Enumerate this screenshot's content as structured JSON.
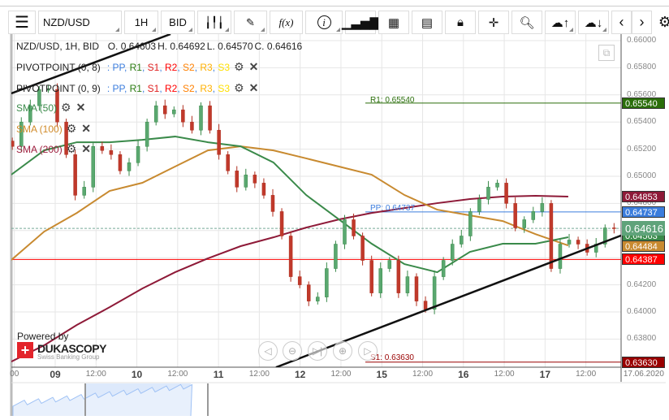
{
  "toolbar": {
    "menu_icon": "hamburger-icon",
    "symbol": "NZD/USD",
    "timeframe": "1H",
    "side": "BID",
    "buttons": [
      "candle-type-icon",
      "pencil-icon",
      "function-icon",
      "info-icon",
      "bar-chart-icon",
      "calendar-icon",
      "report-icon",
      "lock-icon",
      "crosshair-icon",
      "zoom-search-icon",
      "upload-icon",
      "download-icon",
      "chevron-left-icon",
      "chevron-right-icon",
      "gear-icon"
    ],
    "fx": "f(x)",
    "info": "i"
  },
  "ohlc": {
    "title": "NZD/USD, 1H, BID",
    "o": "O. 0.64603",
    "h": "H. 0.64692",
    "l": "L. 0.64570",
    "c": "C. 0.64616"
  },
  "indicators": [
    {
      "name": "PIVOTPOINT (0, 8)",
      "parts": [
        ": ",
        "PP",
        ", ",
        "R1",
        ", ",
        "S1",
        ", ",
        "R2",
        ", ",
        "S2",
        ", ",
        "R3",
        ", ",
        "S3"
      ]
    },
    {
      "name": "PIVOTPOINT (0, 9)",
      "parts": [
        ": ",
        "PP",
        ", ",
        "R1",
        ", ",
        "S1",
        ", ",
        "R2",
        ", ",
        "S2",
        ", ",
        "R3",
        ", ",
        "S3"
      ]
    },
    {
      "name": "SMA (50)",
      "color": "#3a8a4a"
    },
    {
      "name": "SMA (100)",
      "color": "#d08a28"
    },
    {
      "name": "SMA (200)",
      "color": "#a02040"
    }
  ],
  "pivot_colors": {
    "PP": "#3b7ddd",
    "R1": "#2a7a10",
    "S1": "#e02020",
    "R2": "#ff0000",
    "S2": "#ff8000",
    "R3": "#ffb000",
    "S3": "#ffe000"
  },
  "levels": {
    "r1": "R1: 0.65540",
    "pp": "PP: 0.64737",
    "s1": "S1: 0.63630"
  },
  "price_labels": [
    {
      "text": "0.65540",
      "value": 0.6554,
      "color": "#2a6e0a"
    },
    {
      "text": "0.64853",
      "value": 0.64853,
      "color": "#8e1a38"
    },
    {
      "text": "0.64737",
      "value": 0.64737,
      "color": "#3b7ddd"
    },
    {
      "text": "0.64563",
      "value": 0.64563,
      "color": "#3a8a4a"
    },
    {
      "text": "0.64616",
      "value": 0.64616,
      "color": "#5fa37a"
    },
    {
      "text": "0.64484",
      "value": 0.64484,
      "color": "#c88a30"
    },
    {
      "text": "0.64387",
      "value": 0.64387,
      "color": "#ff0000"
    },
    {
      "text": "0.63630",
      "value": 0.6363,
      "color": "#990000"
    }
  ],
  "powered_by": "Powered by",
  "brand": "DUKASCOPY",
  "brand_sub": "Swiss Banking Group",
  "chart_data": {
    "type": "candlestick",
    "symbol": "NZD/USD",
    "interval": "1H",
    "ylim": [
      0.6359,
      0.6605
    ],
    "yticks": [
      "0.66000",
      "0.65800",
      "0.65600",
      "0.65400",
      "0.65200",
      "0.65000",
      "0.64800",
      "0.64600",
      "0.64400",
      "0.64200",
      "0.64000",
      "0.63800"
    ],
    "xticks": [
      {
        "t": -12,
        "label": "00",
        "day": false
      },
      {
        "t": 0,
        "label": "09",
        "day": true
      },
      {
        "t": 12,
        "label": "12:00",
        "day": false
      },
      {
        "t": 24,
        "label": "10",
        "day": true
      },
      {
        "t": 36,
        "label": "12:00",
        "day": false
      },
      {
        "t": 48,
        "label": "11",
        "day": true
      },
      {
        "t": 60,
        "label": "12:00",
        "day": false
      },
      {
        "t": 72,
        "label": "12",
        "day": true
      },
      {
        "t": 84,
        "label": "12:00",
        "day": false
      },
      {
        "t": 96,
        "label": "15",
        "day": true
      },
      {
        "t": 108,
        "label": "12:00",
        "day": false
      },
      {
        "t": 120,
        "label": "16",
        "day": true
      },
      {
        "t": 132,
        "label": "12:00",
        "day": false
      },
      {
        "t": 144,
        "label": "17",
        "day": true
      },
      {
        "t": 156,
        "label": "12:00",
        "day": false
      },
      {
        "t": 173,
        "label": "17.06.2020",
        "day": false
      }
    ],
    "close_start_hour": -12.6,
    "close_step_hours": 2.64,
    "closes": [
      0.6522,
      0.654,
      0.6552,
      0.6564,
      0.6564,
      0.654,
      0.6516,
      0.6486,
      0.6492,
      0.6522,
      0.6519,
      0.6516,
      0.6504,
      0.651,
      0.6522,
      0.654,
      0.6552,
      0.6546,
      0.6549,
      0.654,
      0.6534,
      0.6552,
      0.6534,
      0.6516,
      0.6504,
      0.6492,
      0.6501,
      0.6495,
      0.6486,
      0.6474,
      0.6456,
      0.6426,
      0.642,
      0.6408,
      0.6411,
      0.6432,
      0.645,
      0.6468,
      0.6456,
      0.6438,
      0.6414,
      0.6432,
      0.6438,
      0.6414,
      0.6426,
      0.6408,
      0.6402,
      0.6426,
      0.6438,
      0.645,
      0.6456,
      0.6474,
      0.6483,
      0.6492,
      0.6495,
      0.648,
      0.6462,
      0.6468,
      0.6474,
      0.648,
      0.6432,
      0.645,
      0.6453,
      0.645,
      0.6444,
      0.645,
      0.6462,
      0.64616
    ],
    "sma_start_hour": -12.9,
    "sma_step_hours": 9.63,
    "sma50": [
      0.65012,
      0.65191,
      0.65251,
      0.65251,
      0.65269,
      0.65293,
      0.65251,
      0.65221,
      0.65102,
      0.64862,
      0.64682,
      0.64503,
      0.64353,
      0.64293,
      0.64443,
      0.64503,
      0.64503,
      0.64551
    ],
    "sma100": [
      0.64383,
      0.64592,
      0.6473,
      0.64892,
      0.64952,
      0.65072,
      0.65191,
      0.65221,
      0.65191,
      0.65132,
      0.65072,
      0.65012,
      0.64862,
      0.64754,
      0.64712,
      0.6467,
      0.64574,
      0.6449
    ],
    "sma200": [
      0.63634,
      0.63754,
      0.63904,
      0.64035,
      0.64173,
      0.64293,
      0.64395,
      0.64485,
      0.6455,
      0.64622,
      0.64682,
      0.6473,
      0.64766,
      0.64802,
      0.64832,
      0.6485,
      0.64856,
      0.6485
    ],
    "trendlines": [
      {
        "from": [
          -12.9,
          0.65611
        ],
        "to": [
          33.9,
          0.66048
        ]
      },
      {
        "from": [
          64.9,
          0.63592
        ],
        "to": [
          166.3,
          0.64563
        ]
      }
    ],
    "hlines": {
      "r1": 0.6554,
      "pp": 0.64737,
      "s1": 0.6363,
      "support": 0.64387,
      "current": 0.64616
    }
  }
}
